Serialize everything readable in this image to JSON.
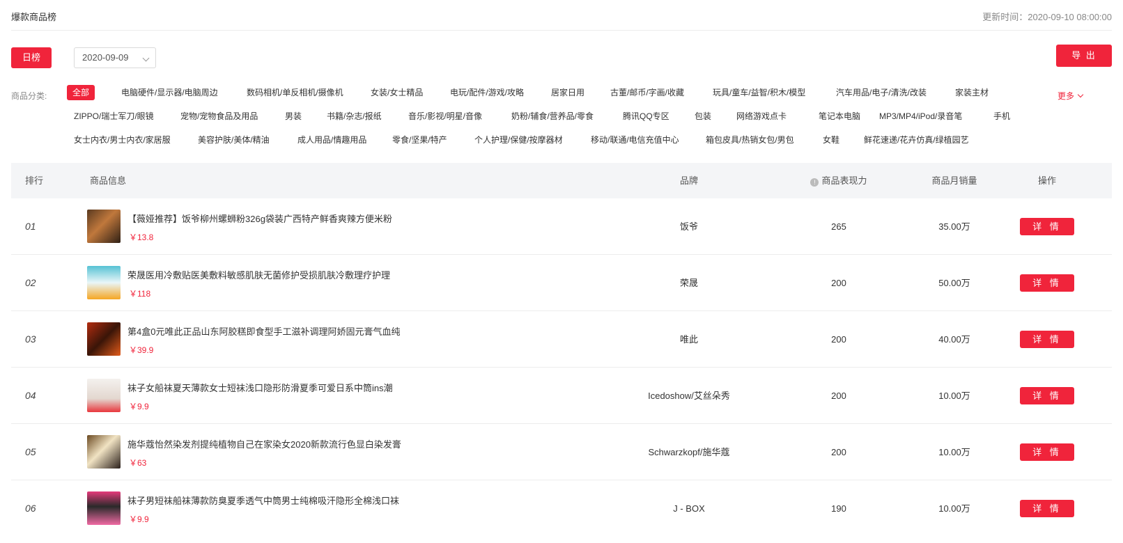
{
  "header": {
    "title": "爆款商品榜",
    "update_label": "更新时间：",
    "update_time": "2020-09-10 08:00:00"
  },
  "toolbar": {
    "daily_label": "日榜",
    "date_value": "2020-09-09",
    "export_label": "导 出"
  },
  "categories": {
    "label": "商品分类:",
    "more_label": "更多",
    "items": [
      "全部",
      "电脑硬件/显示器/电脑周边",
      "数码相机/单反相机/摄像机",
      "女装/女士精品",
      "电玩/配件/游戏/攻略",
      "居家日用",
      "古董/邮币/字画/收藏",
      "玩具/童车/益智/积木/模型",
      "汽车用品/电子/清洗/改装",
      "家装主材",
      "ZIPPO/瑞士军刀/眼镜",
      "宠物/宠物食品及用品",
      "男装",
      "书籍/杂志/报纸",
      "音乐/影视/明星/音像",
      "奶粉/辅食/营养品/零食",
      "腾讯QQ专区",
      "包装",
      "网络游戏点卡",
      "笔记本电脑",
      "MP3/MP4/iPod/录音笔",
      "手机",
      "女士内衣/男士内衣/家居服",
      "美容护肤/美体/精油",
      "成人用品/情趣用品",
      "零食/坚果/特产",
      "个人护理/保健/按摩器材",
      "移动/联通/电信充值中心",
      "箱包皮具/热销女包/男包",
      "女鞋",
      "鲜花速递/花卉仿真/绿植园艺"
    ]
  },
  "table": {
    "headers": {
      "rank": "排行",
      "info": "商品信息",
      "brand": "品牌",
      "performance": "商品表现力",
      "monthly_sales": "商品月销量",
      "action": "操作"
    },
    "rows": [
      {
        "rank": "01",
        "title": "【薇娅推荐】饭爷柳州螺蛳粉326g袋装广西特产鲜香爽辣方便米粉",
        "price": "￥13.8",
        "brand": "饭爷",
        "performance": "265",
        "sales": "35.00万",
        "action": "详 情"
      },
      {
        "rank": "02",
        "title": "荣晟医用冷敷贴医美敷料敏感肌肤无菌修护受损肌肤冷敷理疗护理",
        "price": "￥118",
        "brand": "荣晟",
        "performance": "200",
        "sales": "50.00万",
        "action": "详 情"
      },
      {
        "rank": "03",
        "title": "第4盒0元唯此正品山东阿胶糕即食型手工滋补调理阿娇固元膏气血纯",
        "price": "￥39.9",
        "brand": "唯此",
        "performance": "200",
        "sales": "40.00万",
        "action": "详 情"
      },
      {
        "rank": "04",
        "title": "袜子女船袜夏天薄款女士短袜浅口隐形防滑夏季可爱日系中筒ins潮",
        "price": "￥9.9",
        "brand": "Icedoshow/艾丝朵秀",
        "performance": "200",
        "sales": "10.00万",
        "action": "详 情"
      },
      {
        "rank": "05",
        "title": "施华蔻怡然染发剂提纯植物自己在家染女2020新款流行色显白染发膏",
        "price": "￥63",
        "brand": "Schwarzkopf/施华蔻",
        "performance": "200",
        "sales": "10.00万",
        "action": "详 情"
      },
      {
        "rank": "06",
        "title": "袜子男短袜船袜薄款防臭夏季透气中筒男士纯棉吸汗隐形全棉浅口袜",
        "price": "￥9.9",
        "brand": "J - BOX",
        "performance": "190",
        "sales": "10.00万",
        "action": "详 情"
      }
    ]
  },
  "colors": {
    "accent": "#f0243b",
    "header_bg": "#f4f5f7"
  }
}
